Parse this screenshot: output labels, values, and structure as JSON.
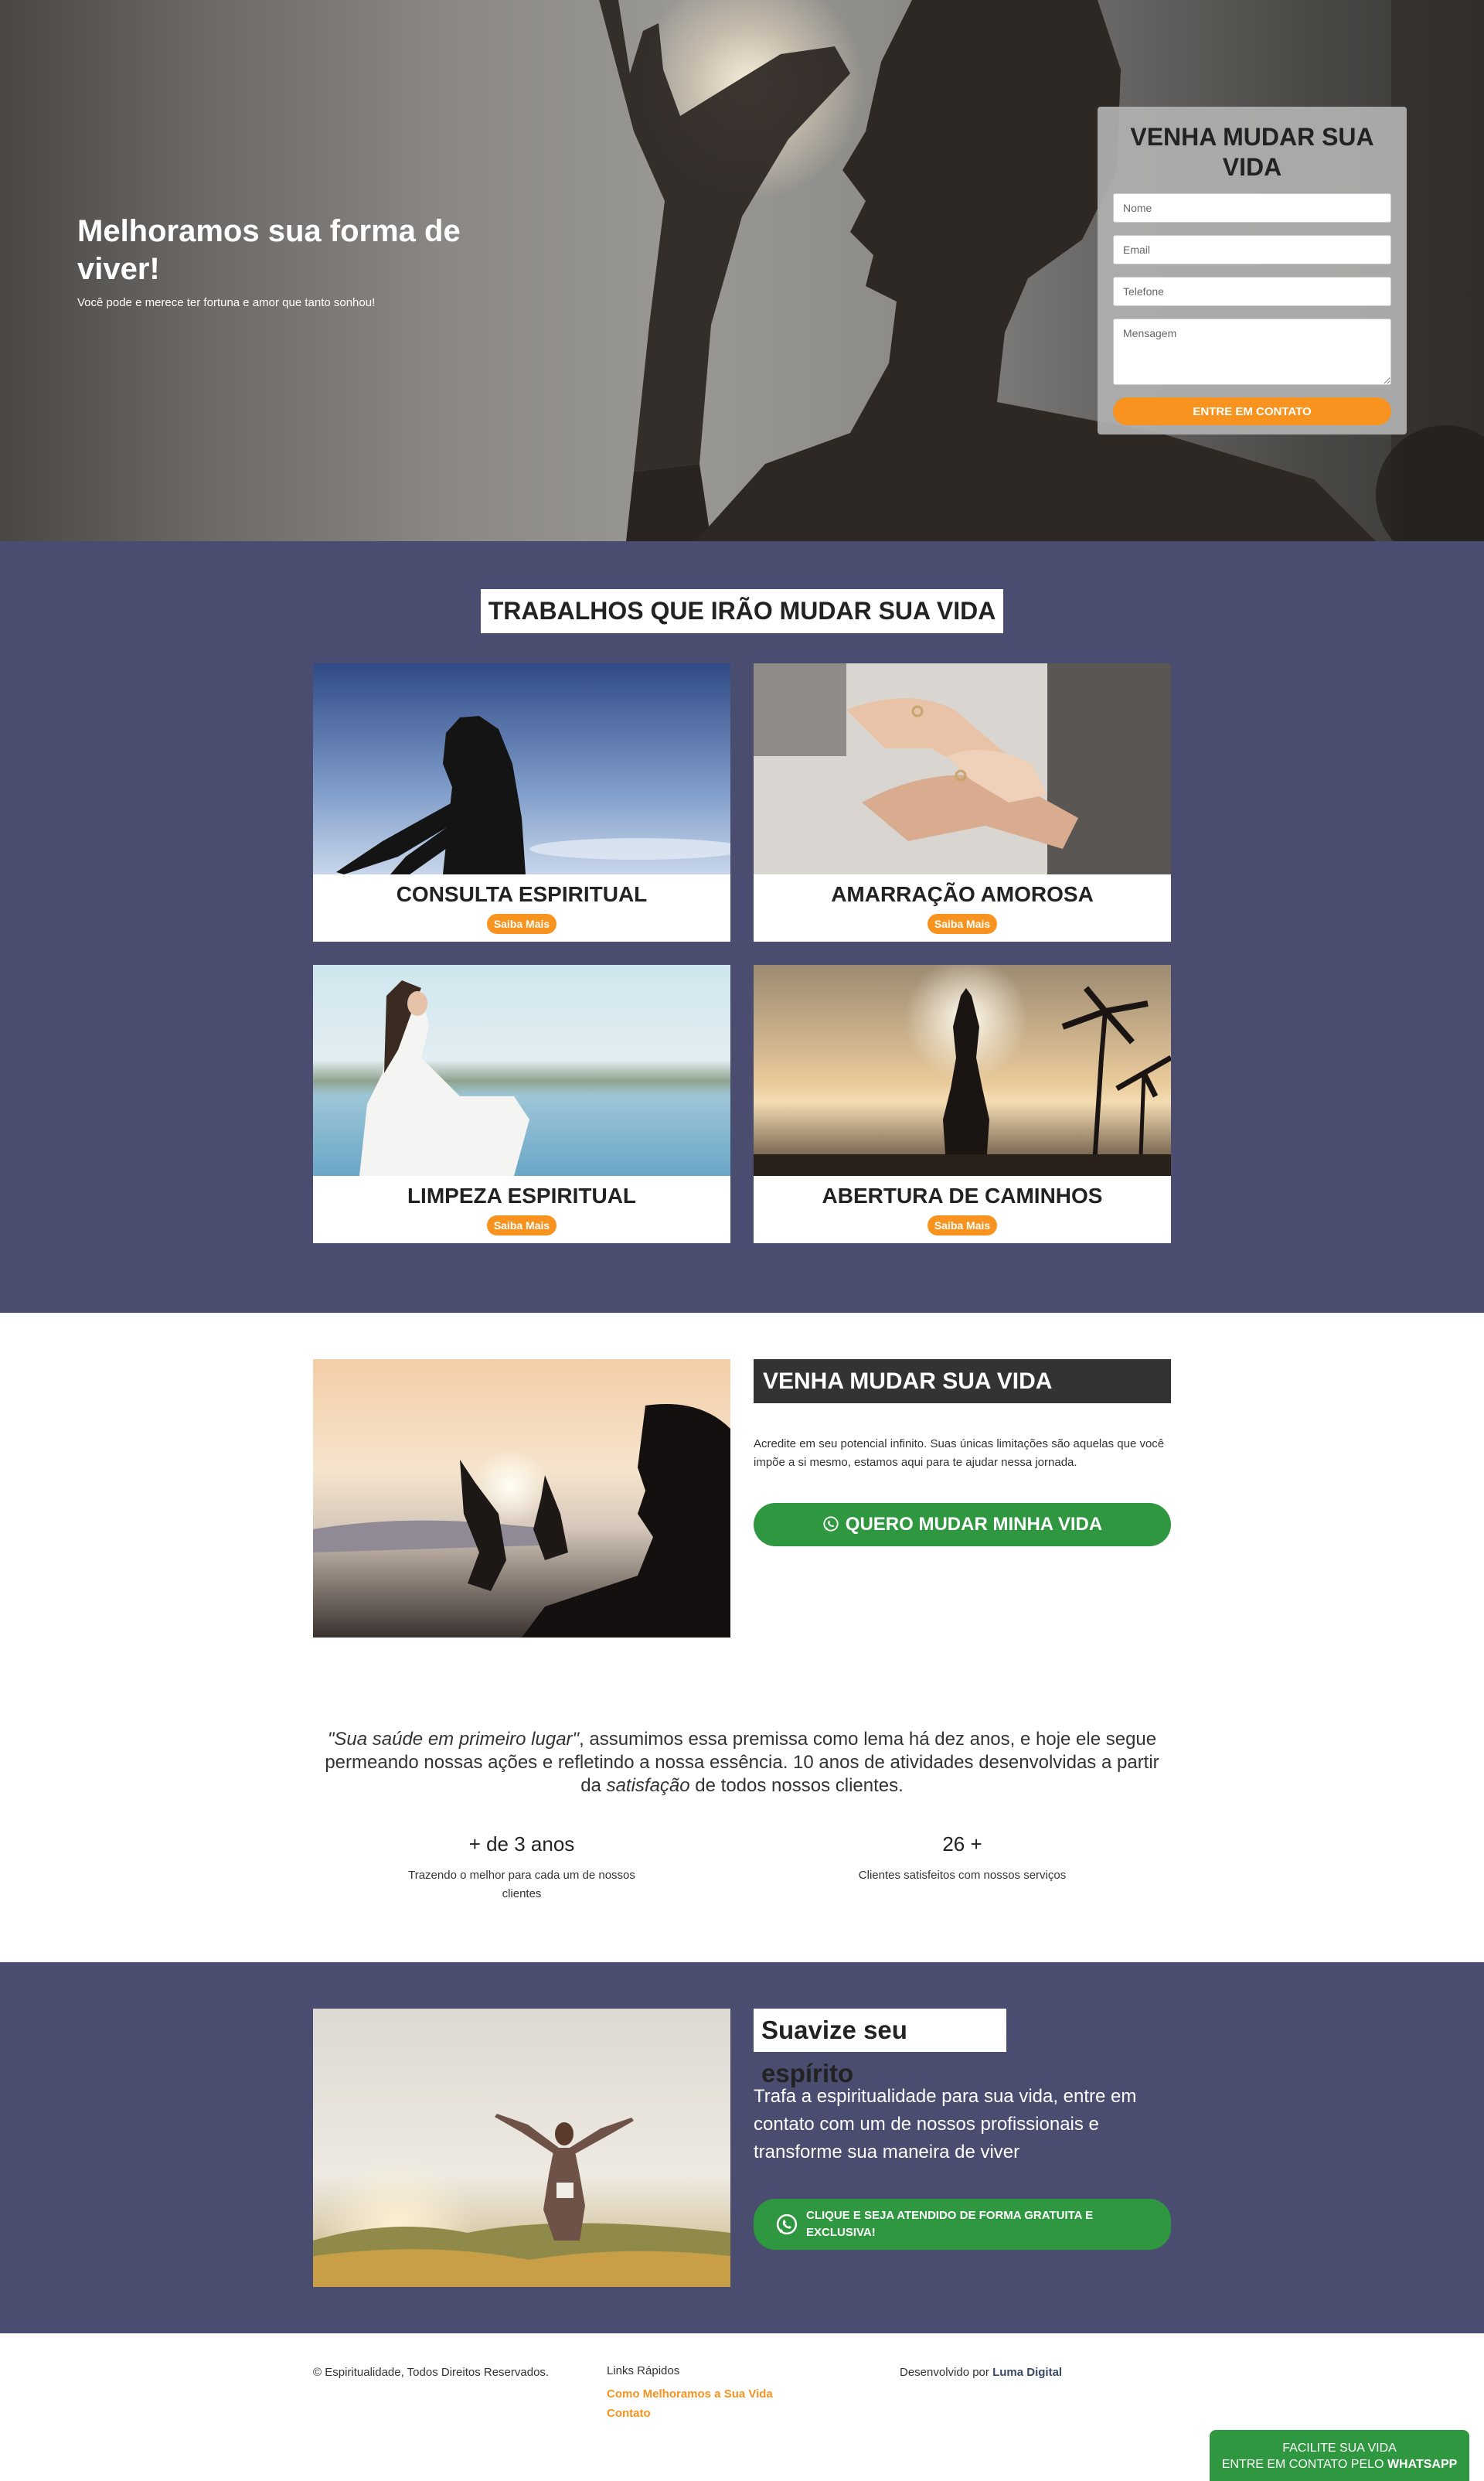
{
  "hero": {
    "title": "Melhoramos sua forma de viver!",
    "subtitle": "Você pode e merece ter fortuna e amor que tanto sonhou!"
  },
  "contact_form": {
    "title": "VENHA MUDAR SUA VIDA",
    "name_placeholder": "Nome",
    "email_placeholder": "Email",
    "phone_placeholder": "Telefone",
    "message_placeholder": "Mensagem",
    "submit_label": "ENTRE EM CONTATO"
  },
  "services": {
    "heading": "TRABALHOS QUE IRÃO MUDAR SUA VIDA",
    "cards": [
      {
        "title": "CONSULTA ESPIRITUAL",
        "button": "Saiba Mais"
      },
      {
        "title": "AMARRAÇÃO AMOROSA",
        "button": "Saiba Mais"
      },
      {
        "title": "LIMPEZA ESPIRITUAL",
        "button": "Saiba Mais"
      },
      {
        "title": "ABERTURA DE CAMINHOS",
        "button": "Saiba Mais"
      }
    ]
  },
  "about": {
    "heading": "VENHA MUDAR SUA VIDA",
    "text": "Acredite em seu potencial infinito. Suas únicas limitações são aquelas que você impõe a si mesmo, estamos aqui para te ajudar nessa jornada.",
    "button_label": "QUERO MUDAR MINHA VIDA",
    "button_icon": "whatsapp-icon",
    "quote_italic": "\"Sua saúde em primeiro lugar\"",
    "quote_part1": ", assumimos essa premissa como lema há dez anos, e hoje ele segue permeando nossas ações e refletindo a nossa essência. 10 anos de atividades desenvolvidas a partir da ",
    "quote_italic2": "satisfação",
    "quote_part2": " de todos nossos clientes.",
    "stats": [
      {
        "value": "+ de 3 anos",
        "label": "Trazendo o melhor para cada um de nossos clientes"
      },
      {
        "value": "26 +",
        "label": "Clientes satisfeitos com nossos serviços"
      }
    ]
  },
  "soothe": {
    "heading": "Suavize seu espírito",
    "text": "Trafa a espiritualidade para sua vida, entre em contato com um de nossos profissionais e transforme sua maneira de viver",
    "button_label": "CLIQUE E SEJA ATENDIDO DE FORMA GRATUITA E EXCLUSIVA!",
    "button_icon": "whatsapp-icon"
  },
  "footer": {
    "copyright": "© Espiritualidade, Todos Direitos Reservados.",
    "links_title": "Links Rápidos",
    "links": [
      "Como Melhoramos a Sua Vida",
      "Contato"
    ],
    "dev_prefix": "Desenvolvido por ",
    "dev_name": "Luma Digital"
  },
  "whatsapp_float": {
    "line1": "FACILITE SUA VIDA",
    "line2_prefix": "ENTRE EM CONTATO PELO ",
    "line2_bold": "WHATSAPP"
  },
  "colors": {
    "accent_orange": "#f7931e",
    "section_navy": "#4a4c70",
    "whatsapp_green": "#2e9740"
  }
}
